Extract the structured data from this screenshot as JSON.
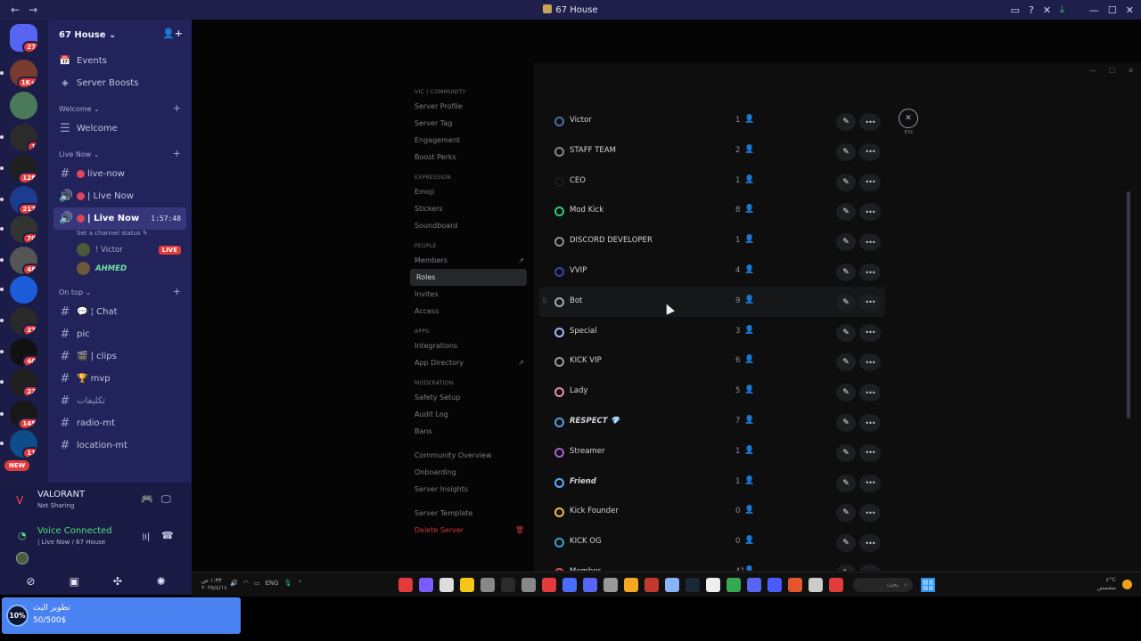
{
  "titlebar": {
    "title": "67 House",
    "back": "←",
    "forward": "→"
  },
  "rail": {
    "servers": [
      {
        "badge": "27",
        "color": "#5865f2"
      },
      {
        "badge": "1K+",
        "color": "#7a3b2f"
      },
      {
        "badge": "",
        "color": "#4b7a5a"
      },
      {
        "badge": "1",
        "color": "#2b2b2b"
      },
      {
        "badge": "128",
        "color": "#1f1f1f"
      },
      {
        "badge": "217",
        "color": "#1d3b8f"
      },
      {
        "badge": "70",
        "color": "#333333"
      },
      {
        "badge": "48",
        "color": "#555555"
      },
      {
        "badge": "",
        "color": "#1d5cd8"
      },
      {
        "badge": "27",
        "color": "#2a2a2a"
      },
      {
        "badge": "40",
        "color": "#111111"
      },
      {
        "badge": "22",
        "color": "#202020"
      },
      {
        "badge": "145",
        "color": "#181818"
      },
      {
        "badge": "11",
        "color": "#0e4d8a"
      }
    ],
    "new_label": "NEW"
  },
  "channels": {
    "server_name": "67 House",
    "top_items": [
      {
        "icon": "📅",
        "label": "Events"
      },
      {
        "icon": "◈",
        "label": "Server Boosts"
      }
    ],
    "welcome_category": "Welcome",
    "welcome_channel": "Welcome",
    "live_category": "Live Now",
    "live_channels": [
      "live-now",
      "| Live Now",
      "| Live Now"
    ],
    "active_timer": "1:57:48",
    "channel_status": "Set a channel status",
    "voice_users": [
      {
        "name": "! Victor",
        "badge": "LIVE"
      },
      {
        "name": "AHMED"
      }
    ],
    "ontop_category": "On top",
    "ontop_channels": [
      "💬 ¦ Chat",
      "pic",
      "🎬 | clips",
      "🏆 mvp",
      "تكليفات",
      "radio-mt",
      "location-mt"
    ]
  },
  "panel": {
    "game": "VALORANT",
    "game_status": "Not Sharing",
    "voice_title": "Voice Connected",
    "voice_sub": "| Live Now / 67 House"
  },
  "toast": {
    "percent": "10%",
    "title": "تطوير البث",
    "progress_text": "50/500$",
    "progress": 0.1
  },
  "settings": {
    "groups": [
      {
        "header": "VIC | COMMUNITY",
        "items": [
          "Server Profile",
          "Server Tag",
          "Engagement",
          "Boost Perks"
        ]
      },
      {
        "header": "EXPRESSION",
        "items": [
          "Emoji",
          "Stickers",
          "Soundboard"
        ]
      },
      {
        "header": "PEOPLE",
        "items": [
          "Members",
          "Roles",
          "Invites",
          "Access"
        ]
      },
      {
        "header": "APPS",
        "items": [
          "Integrations",
          "App Directory"
        ]
      },
      {
        "header": "MODERATION",
        "items": [
          "Safety Setup",
          "Audit Log",
          "Bans"
        ]
      },
      {
        "header": "",
        "items": [
          "Community Overview",
          "Onboarding",
          "Server Insights"
        ]
      },
      {
        "header": "",
        "items": [
          "Server Template",
          "Delete Server"
        ]
      }
    ],
    "selected": "Roles",
    "esc": "ESC"
  },
  "roles": [
    {
      "name": "Victor",
      "count": "1",
      "color": "#4a6fa5"
    },
    {
      "name": "STAFF TEAM",
      "count": "2",
      "color": "#7a8a95"
    },
    {
      "name": "CEO",
      "count": "1",
      "color": "#1c1c1c"
    },
    {
      "name": "Mod Kick",
      "count": "8",
      "color": "#2ecc71"
    },
    {
      "name": "DISCORD DEVELOPER",
      "count": "1",
      "color": "#8a8f98"
    },
    {
      "name": "VVIP",
      "count": "4",
      "color": "#3b3fae"
    },
    {
      "name": "Bot",
      "count": "9",
      "color": "#a5a8b4"
    },
    {
      "name": "Special",
      "count": "3",
      "color": "#a9b4ff"
    },
    {
      "name": "KICK VIP",
      "count": "6",
      "color": "#9a9a9a"
    },
    {
      "name": "Lady",
      "count": "5",
      "color": "#f08ab0"
    },
    {
      "name": "RESPECT 💎",
      "count": "7",
      "color": "#4fa3d9",
      "italic": true
    },
    {
      "name": "Streamer",
      "count": "1",
      "color": "#b05bd8"
    },
    {
      "name": "Friend",
      "count": "1",
      "color": "#5aa9ff",
      "italic": true
    },
    {
      "name": "Kick Founder",
      "count": "0",
      "color": "#e8c23c"
    },
    {
      "name": "KICK OG",
      "count": "0",
      "color": "#3aa0c8"
    },
    {
      "name": "Member",
      "count": "41",
      "color": "#d9534f"
    }
  ],
  "taskbar": {
    "time": "١:٣٣ ص",
    "date": "٢٠٢٥/٤/١٤",
    "lang": "ENG",
    "search": "بحث",
    "weather_temp": "٤°C",
    "weather_label": "مشمس"
  }
}
